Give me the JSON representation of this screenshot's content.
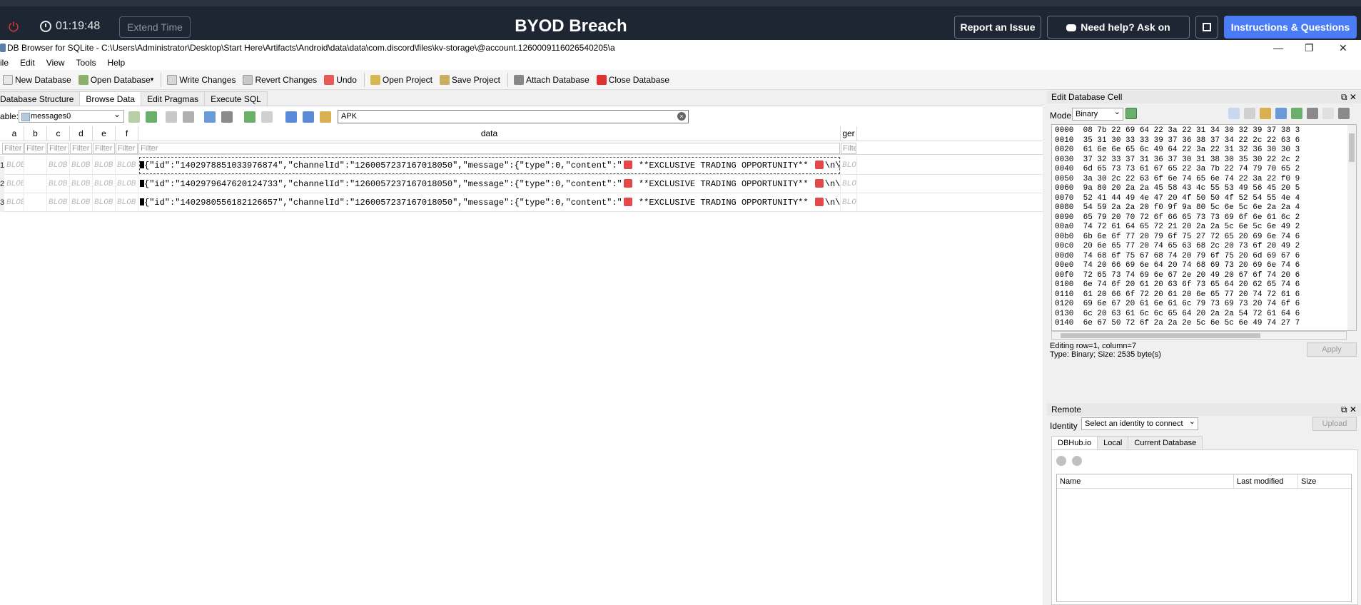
{
  "topbar": {
    "timer": "01:19:48",
    "extend_label": "Extend Time",
    "title": "BYOD Breach",
    "report_label": "Report an Issue",
    "discord_label": "Need help? Ask on Discord",
    "instructions_label": "Instructions & Questions"
  },
  "window": {
    "title": "DB Browser for SQLite - C:\\Users\\Administrator\\Desktop\\Start Here\\Artifacts\\Android\\data\\data\\com.discord\\files\\kv-storage\\@account.1260009116026540205\\a"
  },
  "menu": [
    "ile",
    "Edit",
    "View",
    "Tools",
    "Help"
  ],
  "toolbar": {
    "new_db": "New Database",
    "open_db": "Open Database",
    "write": "Write Changes",
    "revert": "Revert Changes",
    "undo": "Undo",
    "open_project": "Open Project",
    "save_project": "Save Project",
    "attach": "Attach Database",
    "close": "Close Database"
  },
  "tabs": [
    "Database Structure",
    "Browse Data",
    "Edit Pragmas",
    "Execute SQL"
  ],
  "browse": {
    "table_label": "able:",
    "table_value": "messages0",
    "search_value": "APK"
  },
  "grid": {
    "columns": [
      "a",
      "b",
      "c",
      "d",
      "e",
      "f",
      "data",
      "ger"
    ],
    "filter_placeholder": "Filter",
    "blob_text": "BLOB",
    "row_numbers": [
      "1",
      "2",
      "3"
    ],
    "rows": [
      {
        "data_prefix": "{\"id\":\"1402978851033976874\",\"channelId\":\"1260057237167018050\",\"message\":{\"type\":0,\"content\":\"",
        "data_suffix": " **EXCLUSIVE TRADING OPPORTUNITY** ",
        "data_tail": "\\n\\n**Hey …"
      },
      {
        "data_prefix": "{\"id\":\"1402979647620124733\",\"channelId\":\"1260057237167018050\",\"message\":{\"type\":0,\"content\":\"",
        "data_suffix": " **EXCLUSIVE TRADING OPPORTUNITY** ",
        "data_tail": "\\n\\n**Hey …"
      },
      {
        "data_prefix": "{\"id\":\"1402980556182126657\",\"channelId\":\"1260057237167018050\",\"message\":{\"type\":0,\"content\":\"",
        "data_suffix": " **EXCLUSIVE TRADING OPPORTUNITY** ",
        "data_tail": "\\n\\n**Hey …"
      }
    ]
  },
  "edit_cell": {
    "title": "Edit Database Cell",
    "mode_label": "Mode:",
    "mode_value": "Binary",
    "hex_lines": [
      "0000  08 7b 22 69 64 22 3a 22 31 34 30 32 39 37 38 3",
      "0010  35 31 30 33 33 39 37 36 38 37 34 22 2c 22 63 6",
      "0020  61 6e 6e 65 6c 49 64 22 3a 22 31 32 36 30 30 3",
      "0030  37 32 33 37 31 36 37 30 31 38 30 35 30 22 2c 2",
      "0040  6d 65 73 73 61 67 65 22 3a 7b 22 74 79 70 65 2",
      "0050  3a 30 2c 22 63 6f 6e 74 65 6e 74 22 3a 22 f0 9",
      "0060  9a 80 20 2a 2a 45 58 43 4c 55 53 49 56 45 20 5",
      "0070  52 41 44 49 4e 47 20 4f 50 50 4f 52 54 55 4e 4",
      "0080  54 59 2a 2a 20 f0 9f 9a 80 5c 6e 5c 6e 2a 2a 4",
      "0090  65 79 20 70 72 6f 66 65 73 73 69 6f 6e 61 6c 2",
      "00a0  74 72 61 64 65 72 21 20 2a 2a 5c 6e 5c 6e 49 2",
      "00b0  6b 6e 6f 77 20 79 6f 75 27 72 65 20 69 6e 74 6",
      "00c0  20 6e 65 77 20 74 65 63 68 2c 20 73 6f 20 49 2",
      "00d0  74 68 6f 75 67 68 74 20 79 6f 75 20 6d 69 67 6",
      "00e0  74 20 66 69 6e 64 20 74 68 69 73 20 69 6e 74 6",
      "00f0  72 65 73 74 69 6e 67 2e 20 49 20 67 6f 74 20 6",
      "0100  6e 74 6f 20 61 20 63 6f 73 65 64 20 62 65 74 6",
      "0110  61 20 66 6f 72 20 61 20 6e 65 77 20 74 72 61 6",
      "0120  69 6e 67 20 61 6e 61 6c 79 73 69 73 20 74 6f 6",
      "0130  6c 20 63 61 6c 6c 65 64 20 2a 2a 54 72 61 64 6",
      "0140  6e 67 50 72 6f 2a 2a 2e 5c 6e 5c 6e 49 74 27 7"
    ],
    "editing_info": "Editing row=1, column=7",
    "type_info": "Type: Binary; Size: 2535 byte(s)",
    "apply_label": "Apply"
  },
  "remote": {
    "title": "Remote",
    "identity_label": "Identity",
    "identity_value": "Select an identity to connect",
    "upload_label": "Upload",
    "tabs": [
      "DBHub.io",
      "Local",
      "Current Database"
    ],
    "columns": [
      "Name",
      "Last modified",
      "Size"
    ]
  }
}
